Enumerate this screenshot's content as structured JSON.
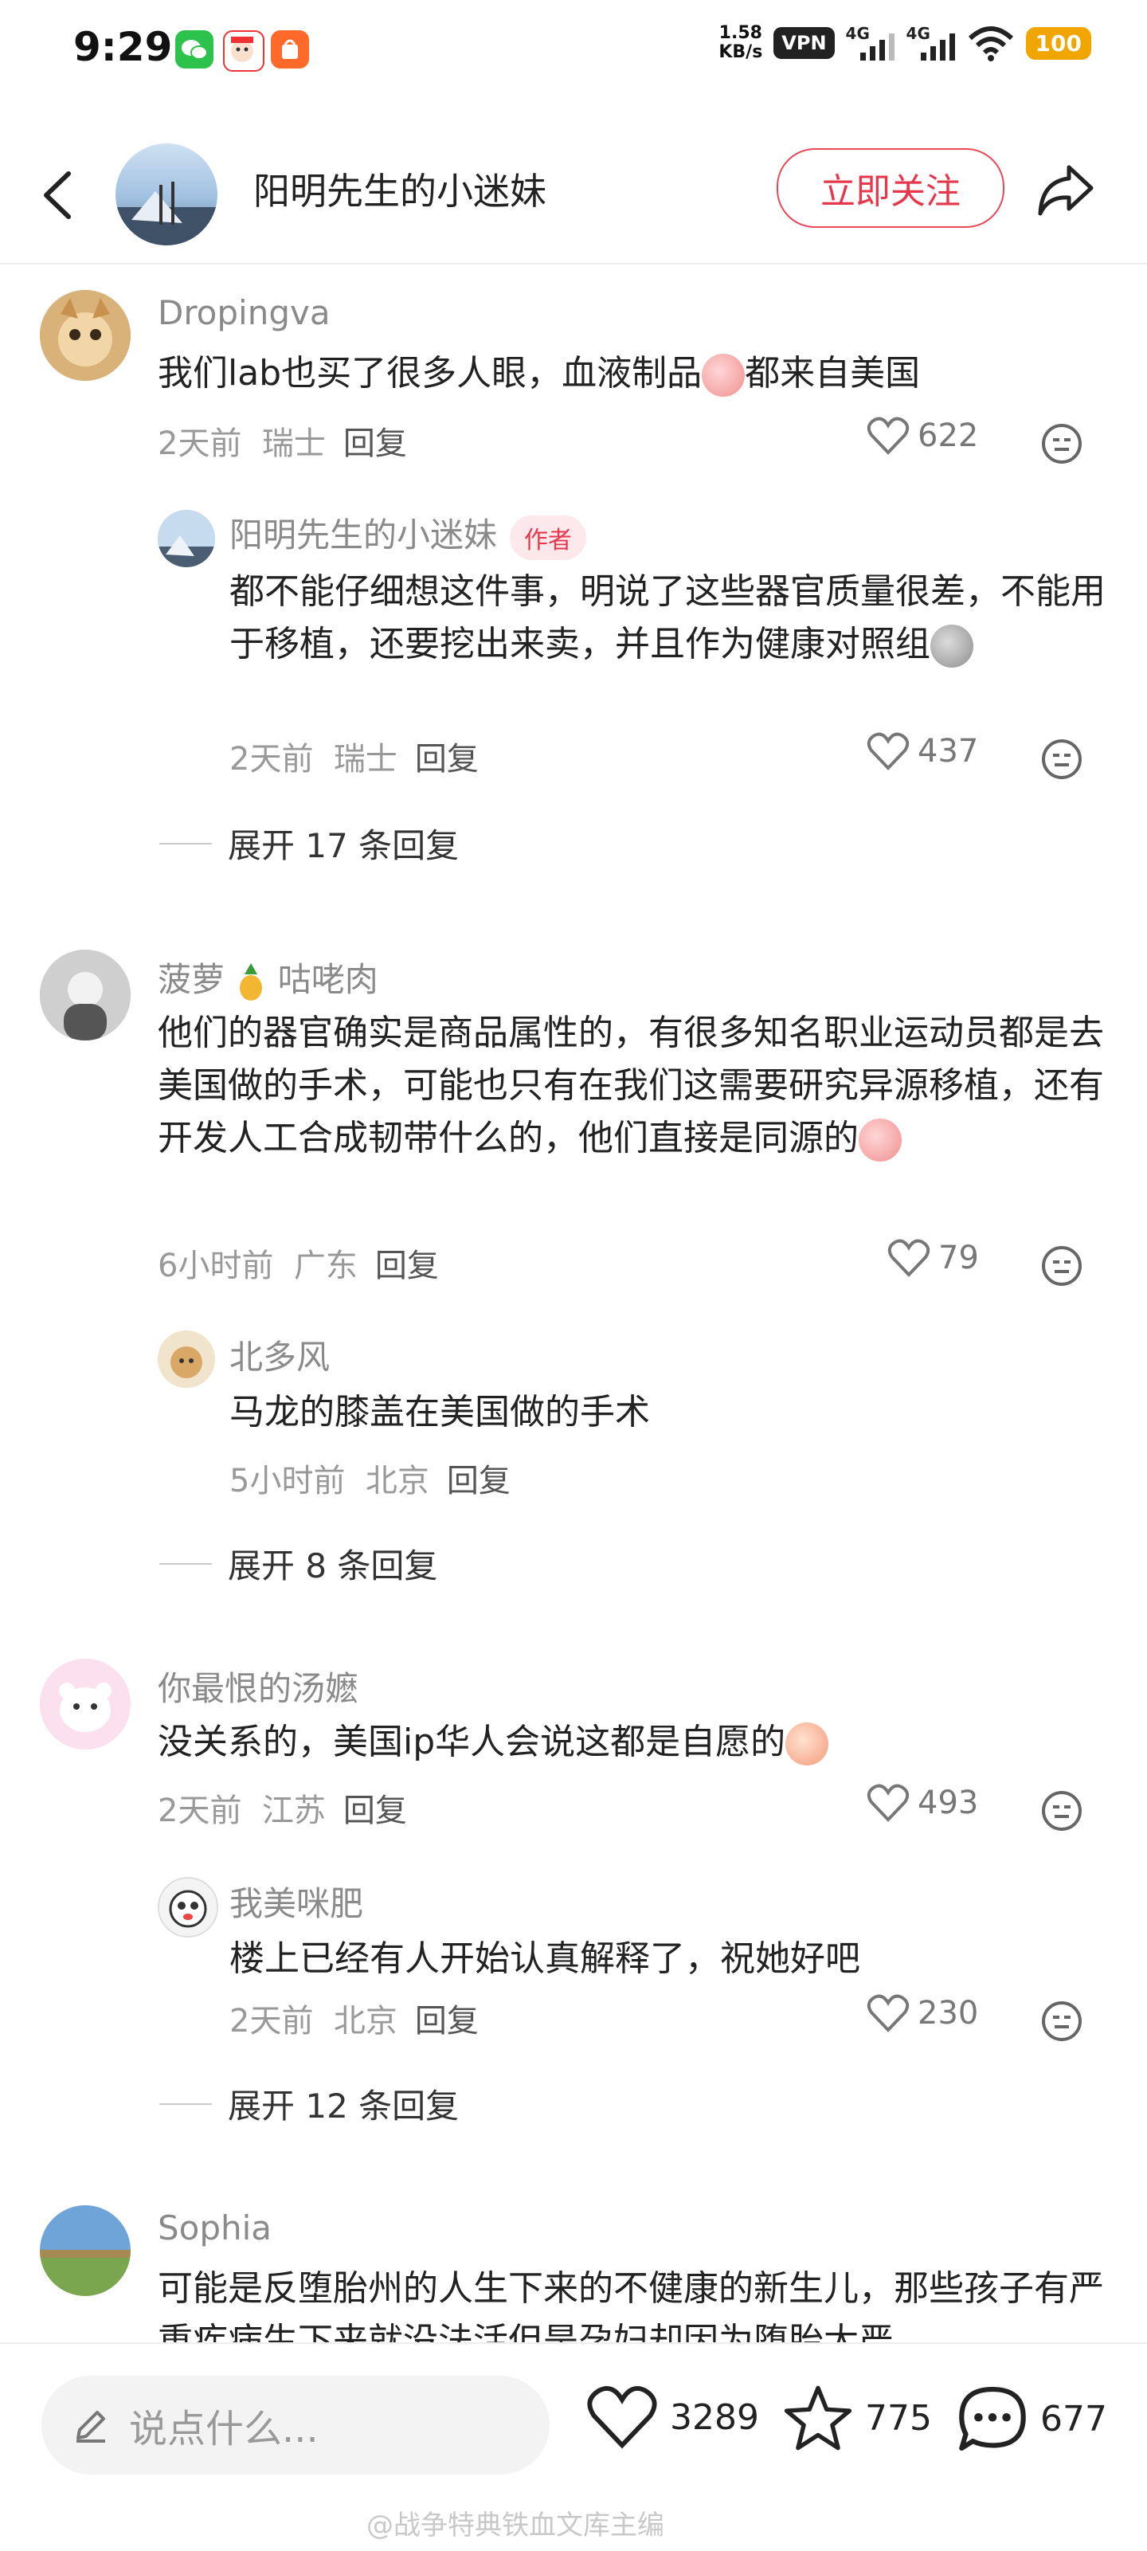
{
  "status_bar": {
    "time": "9:29",
    "net_speed_value": "1.58",
    "net_speed_unit": "KB/s",
    "vpn": "VPN",
    "signal1": "4G",
    "signal2": "4G",
    "battery": "100"
  },
  "header": {
    "title": "阳明先生的小迷妹",
    "follow_label": "立即关注"
  },
  "comments": [
    {
      "user": "Dropingva",
      "text": "我们lab也买了很多人眼，血液制品",
      "text_after": "都来自美国",
      "time": "2天前",
      "location": "瑞士",
      "reply_label": "回复",
      "likes": "622",
      "reply": {
        "user": "阳明先生的小迷妹",
        "badge": "作者",
        "text": "都不能仔细想这件事，明说了这些器官质量很差，不能用于移植，还要挖出来卖，并且作为健康对照组",
        "time": "2天前",
        "location": "瑞士",
        "reply_label": "回复",
        "likes": "437"
      },
      "expand": "展开 17 条回复"
    },
    {
      "user_prefix": "菠萝",
      "user_suffix": "咕咾肉",
      "text": "他们的器官确实是商品属性的，有很多知名职业运动员都是去美国做的手术，可能也只有在我们这需要研究异源移植，还有开发人工合成韧带什么的，他们直接是同源的",
      "time": "6小时前",
      "location": "广东",
      "reply_label": "回复",
      "likes": "79",
      "reply": {
        "user": "北多风",
        "text": "马龙的膝盖在美国做的手术",
        "time": "5小时前",
        "location": "北京",
        "reply_label": "回复"
      },
      "expand": "展开 8 条回复"
    },
    {
      "user": "你最恨的汤嬷",
      "text": "没关系的，美国ip华人会说这都是自愿的",
      "time": "2天前",
      "location": "江苏",
      "reply_label": "回复",
      "likes": "493",
      "reply": {
        "user": "我美咪肥",
        "text": "楼上已经有人开始认真解释了，祝她好吧",
        "time": "2天前",
        "location": "北京",
        "reply_label": "回复",
        "likes": "230"
      },
      "expand": "展开 12 条回复"
    },
    {
      "user": "Sophia",
      "text": "可能是反堕胎州的人生下来的不健康的新生儿，那些孩子有严重疾病生下来就没法活但是孕妇却因为堕胎太严"
    }
  ],
  "bottom_bar": {
    "input_placeholder": "说点什么...",
    "likes": "3289",
    "favorites": "775",
    "comments": "677",
    "watermark": "@战争特典铁血文库主编"
  }
}
